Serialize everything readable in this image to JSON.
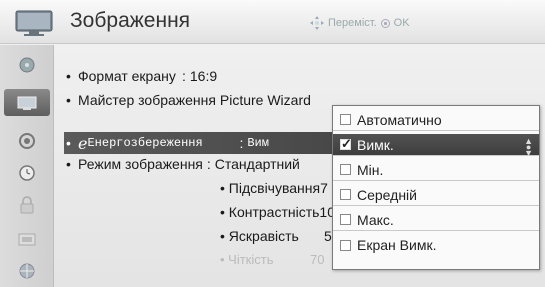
{
  "header": {
    "title": "Зображення",
    "hint": "Переміст.",
    "ok": "OK"
  },
  "sidebar": {
    "items": [
      {
        "icon": "satellite-dish-icon"
      },
      {
        "icon": "tv-picture-icon",
        "active": true
      },
      {
        "icon": "audio-icon"
      },
      {
        "icon": "clock-icon"
      },
      {
        "icon": "lock-icon"
      },
      {
        "icon": "option-icon"
      },
      {
        "icon": "network-icon"
      }
    ]
  },
  "menu": {
    "items": [
      {
        "bullet": "•",
        "label": "Формат екрану",
        "sep": ":",
        "value": "16:9"
      },
      {
        "bullet": "•",
        "label": "Майстер зображення Picture Wizard"
      },
      {
        "bullet": "•",
        "eco": "e",
        "label": "Енергозбереження",
        "sep": ":",
        "value": "Вим"
      },
      {
        "bullet": "•",
        "label": "Режим зображення",
        "sep": ":",
        "value": "Стандартний"
      }
    ],
    "sub_items": [
      {
        "label": "• Підсвічування",
        "value": "7"
      },
      {
        "label": "• Контрастність",
        "value": "10"
      },
      {
        "label": "• Яскравість",
        "value": "5"
      },
      {
        "label": "• Чіткість",
        "value": "70"
      }
    ]
  },
  "dropdown": {
    "options": [
      {
        "label": "Автоматично",
        "checked": false
      },
      {
        "label": "Вимк.",
        "checked": true
      },
      {
        "label": "Мін.",
        "checked": false
      },
      {
        "label": "Середній",
        "checked": false
      },
      {
        "label": "Макс.",
        "checked": false
      },
      {
        "label": "Екран Вимк.",
        "checked": false
      }
    ]
  }
}
